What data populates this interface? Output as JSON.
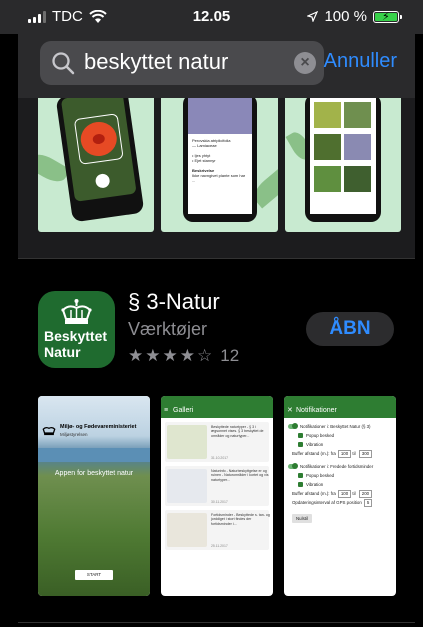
{
  "status_bar": {
    "carrier": "TDC",
    "time": "12.05",
    "battery": "100 %",
    "battery_level": 1.0,
    "battery_color": "#38d14a"
  },
  "search": {
    "query": "beskyttet natur",
    "cancel_label": "Annuller"
  },
  "app": {
    "name": "§ 3-Natur",
    "category": "Værktøjer",
    "rating_stars": 4,
    "rating_max": 5,
    "rating_count": "12",
    "open_label": "ÅBN",
    "icon_text_line1": "Beskyttet",
    "icon_text_line2": "Natur",
    "icon_color": "#1f6b2f"
  },
  "screenshots": {
    "s1": {
      "org": "Miljø- og Fødevareministeriet",
      "org_sub": "Miljøstyrelsen",
      "tagline": "Appen for beskyttet natur",
      "start_label": "START"
    },
    "s2": {
      "title": "Galleri",
      "items": [
        {
          "text": "Beskyttede naturtyper - § 3 i ægsonnet vises. § 3 beskyttet de områder og naturtyper...",
          "date": "31.10.2017"
        },
        {
          "text": "Naturinfo - Naturbeskyttgelse er og ruinen - Naturområder i kortet og vis naturtyper...",
          "date": "30.11.2017"
        },
        {
          "text": "Fortidsminder - Beskyttede s. tan- og jorddiget i stort findes der fortidsminder i...",
          "date": "25.11.2017"
        }
      ]
    },
    "s3": {
      "title": "Notifikationer",
      "t1": "Notifikationer i: Beskyttet Natur (§ 3)",
      "popup": "Popup besked",
      "vibration": "Vibration",
      "buffer1": "Buffer afstand (m.): fra",
      "buffer1_from": "100",
      "buffer1_to": "300",
      "t2": "Notifikationer i: Fredede fortidsminder",
      "popup2": "Popup besked",
      "vibration2": "Vibration",
      "buffer2": "Buffer afstand (m.): fra",
      "buffer2_from": "100",
      "buffer2_to": "200",
      "gps": "Opdateringsinterval af GPS position",
      "gps_val": "5",
      "save_label": "Nulstil"
    }
  }
}
